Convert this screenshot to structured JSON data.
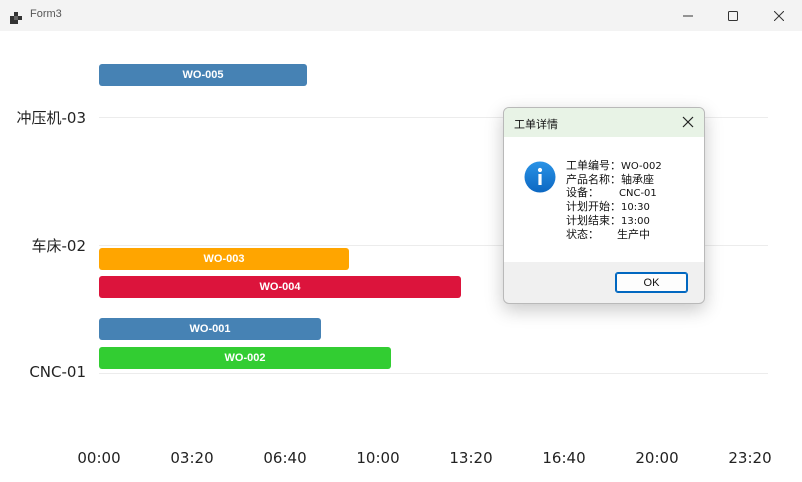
{
  "window": {
    "title": "Form3",
    "controls": [
      "minimize-icon",
      "maximize-icon",
      "close-icon"
    ]
  },
  "gantt": {
    "rows": [
      {
        "label": "冲压机-03"
      },
      {
        "label": "车床-02"
      },
      {
        "label": "CNC-01"
      }
    ],
    "bars": [
      {
        "label": "WO-005",
        "color": "#4682b4",
        "start": "00:00",
        "end": "07:30"
      },
      {
        "label": "WO-003",
        "color": "#ffa500",
        "start": "00:00",
        "end": "09:00"
      },
      {
        "label": "WO-004",
        "color": "#dc143c",
        "start": "00:00",
        "end": "13:00"
      },
      {
        "label": "WO-001",
        "color": "#4682b4",
        "start": "00:00",
        "end": "08:00"
      },
      {
        "label": "WO-002",
        "color": "#32cd32",
        "start": "00:00",
        "end": "10:30"
      }
    ],
    "x_ticks": [
      "00:00",
      "03:20",
      "06:40",
      "10:00",
      "13:20",
      "16:40",
      "20:00",
      "23:20"
    ]
  },
  "dialog": {
    "title": "工单详情",
    "icon": "info-icon",
    "lines": [
      {
        "label": "工单编号：",
        "value": "WO-002"
      },
      {
        "label": "产品名称：",
        "value": "轴承座"
      },
      {
        "label": "设备：",
        "value": "CNC-01"
      },
      {
        "label": "计划开始：",
        "value": "10:30"
      },
      {
        "label": "计划结束：",
        "value": "13:00"
      },
      {
        "label": "状态：",
        "value": "生产中"
      }
    ],
    "ok_label": "OK"
  }
}
